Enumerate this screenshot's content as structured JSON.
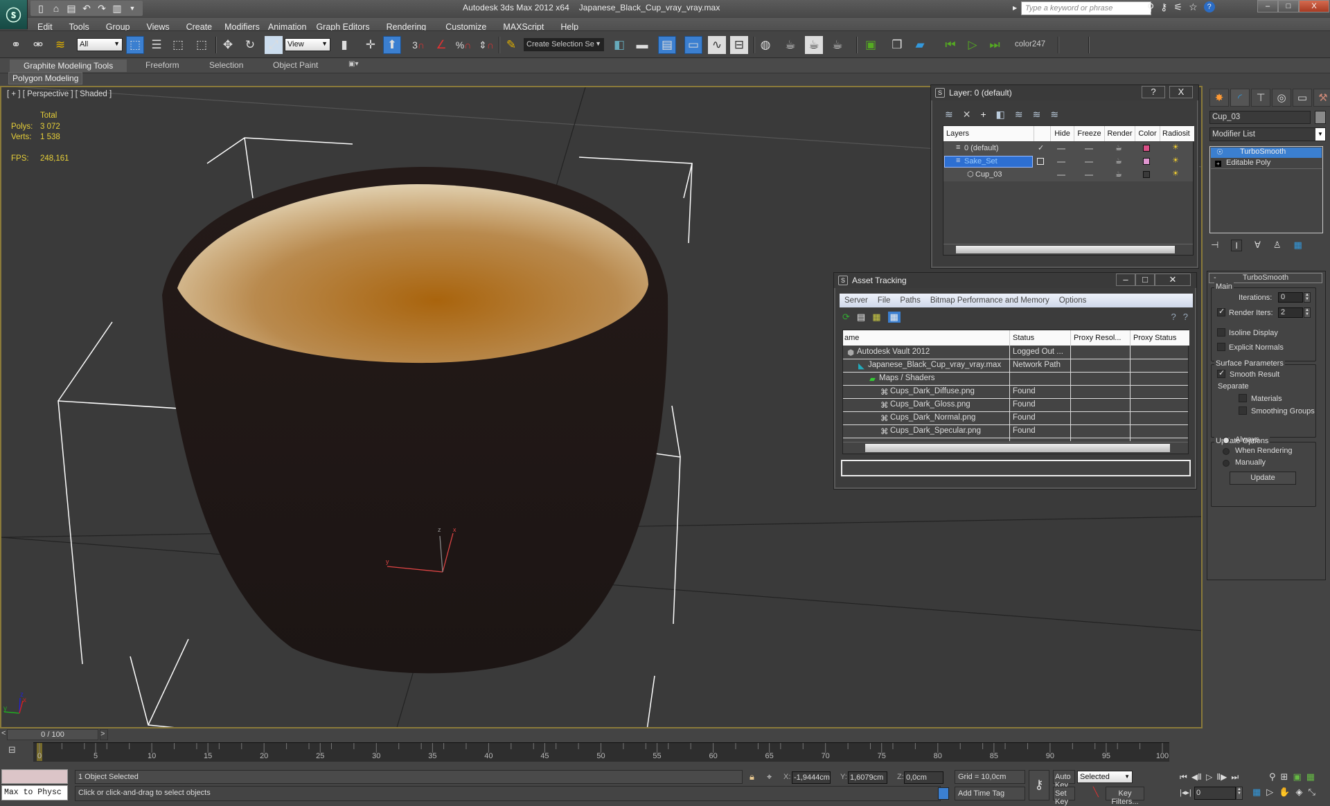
{
  "titlebar": {
    "app_title": "Autodesk 3ds Max  2012 x64",
    "file_name": "Japanese_Black_Cup_vray_vray.max",
    "search_placeholder": "Type a keyword or phrase",
    "window_buttons": [
      "–",
      "□",
      "X"
    ]
  },
  "quick_access": [
    "new-icon",
    "open-icon",
    "save-icon",
    "undo-icon",
    "redo-icon",
    "project-icon"
  ],
  "menu": [
    "Edit",
    "Tools",
    "Group",
    "Views",
    "Create",
    "Modifiers",
    "Animation",
    "Graph Editors",
    "Rendering",
    "Customize",
    "MAXScript",
    "Help"
  ],
  "toolbar": {
    "selection_filter": "All",
    "reference_coord": "View",
    "named_selection": "Create Selection Se",
    "snap_label": "3",
    "color_label": "color247"
  },
  "ribbon": {
    "tabs": [
      "Graphite Modeling Tools",
      "Freeform",
      "Selection",
      "Object Paint"
    ],
    "panel": "Polygon Modeling"
  },
  "viewport": {
    "label": "[ + ] [ Perspective ] [ Shaded ]",
    "stats": {
      "header": "Total",
      "polys_label": "Polys:",
      "polys": "3 072",
      "verts_label": "Verts:",
      "verts": "1 538",
      "fps_label": "FPS:",
      "fps": "248,161"
    },
    "gizmo_axes": [
      "z",
      "x",
      "y"
    ]
  },
  "layer_dialog": {
    "title": "Layer: 0 (default)",
    "help": "?",
    "close": "X",
    "columns": [
      "Layers",
      "",
      "Hide",
      "Freeze",
      "Render",
      "Color",
      "Radiosit"
    ],
    "rows": [
      {
        "name": "0 (default)",
        "active": "✓",
        "color": "#d94f86",
        "selected": false
      },
      {
        "name": "Sake_Set",
        "active": "",
        "color": "#e096d0",
        "selected": true
      },
      {
        "name": "Cup_03",
        "active": "",
        "color": "#3a3a3a",
        "selected": false
      }
    ]
  },
  "asset_tracking": {
    "title": "Asset Tracking",
    "menu": [
      "Server",
      "File",
      "Paths",
      "Bitmap Performance and Memory",
      "Options"
    ],
    "columns": [
      "ame",
      "Status",
      "Proxy Resol...",
      "Proxy Status"
    ],
    "rows": [
      {
        "name": "Autodesk Vault 2012",
        "status": "Logged Out ..."
      },
      {
        "name": "Japanese_Black_Cup_vray_vray.max",
        "status": "Network Path"
      },
      {
        "name": "Maps / Shaders",
        "status": ""
      },
      {
        "name": "Cups_Dark_Diffuse.png",
        "status": "Found"
      },
      {
        "name": "Cups_Dark_Gloss.png",
        "status": "Found"
      },
      {
        "name": "Cups_Dark_Normal.png",
        "status": "Found"
      },
      {
        "name": "Cups_Dark_Specular.png",
        "status": "Found"
      }
    ]
  },
  "command_panel": {
    "object_name": "Cup_03",
    "modifier_list": "Modifier List",
    "stack": [
      "TurboSmooth",
      "Editable Poly"
    ],
    "rollout_title": "TurboSmooth",
    "main_group": "Main",
    "iterations_label": "Iterations:",
    "iterations": "0",
    "render_iters_label": "Render Iters:",
    "render_iters": "2",
    "render_iters_checked": true,
    "isoline": "Isoline Display",
    "explicit_normals": "Explicit Normals",
    "surface_group": "Surface Parameters",
    "smooth_result": "Smooth Result",
    "separate": "Separate",
    "materials": "Materials",
    "smoothing_groups": "Smoothing Groups",
    "update_group": "Update Options",
    "update_options": [
      "Always",
      "When Rendering",
      "Manually"
    ],
    "update_selected": "Always",
    "update_button": "Update"
  },
  "timeline": {
    "current": "0 / 100",
    "prev": "<",
    "next": ">",
    "frame_start": 0,
    "frame_end": 100,
    "current_frame": 0,
    "ticks": [
      "0",
      "5",
      "10",
      "15",
      "20",
      "25",
      "30",
      "35",
      "40",
      "45",
      "50",
      "55",
      "60",
      "65",
      "70",
      "75",
      "80",
      "85",
      "90",
      "95",
      "100"
    ]
  },
  "status": {
    "script_listener": "Max to Physc",
    "selection": "1 Object Selected",
    "prompt": "Click or click-and-drag to select objects",
    "x_label": "X:",
    "x": "-1,9444cm",
    "y_label": "Y:",
    "y": "1,6079cm",
    "z_label": "Z:",
    "z": "0,0cm",
    "grid": "Grid = 10,0cm",
    "add_time_tag": "Add Time Tag",
    "auto_key": "Auto Key",
    "set_key": "Set Key",
    "key_mode": "Selected",
    "key_filters": "Key Filters...",
    "frame_field": "0"
  }
}
